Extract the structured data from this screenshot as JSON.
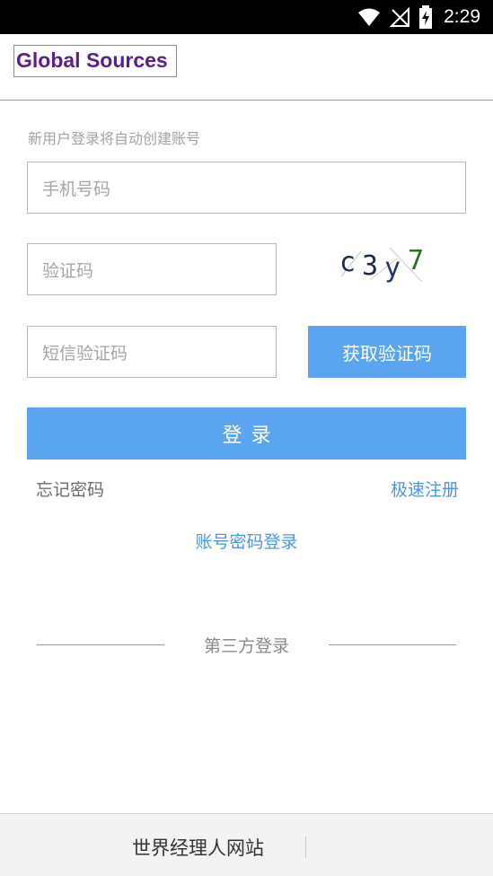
{
  "status_bar": {
    "time": "2:29",
    "icons": [
      "wifi-icon",
      "signal-icon",
      "battery-icon"
    ]
  },
  "header": {
    "logo_text": "Global Sources"
  },
  "form": {
    "hint": "新用户登录将自动创建账号",
    "phone_placeholder": "手机号码",
    "captcha_placeholder": "验证码",
    "captcha_image_text": "c3y7",
    "sms_placeholder": "短信验证码",
    "get_code_label": "获取验证码",
    "login_label": "登录"
  },
  "links": {
    "forgot_password": "忘记密码",
    "quick_register": "极速注册",
    "account_login": "账号密码登录"
  },
  "third_party": {
    "label": "第三方登录"
  },
  "footer": {
    "site_link": "世界经理人网站"
  },
  "colors": {
    "accent": "#5ba5f0",
    "link": "#4a96e6",
    "logo": "#5a1f8c"
  }
}
